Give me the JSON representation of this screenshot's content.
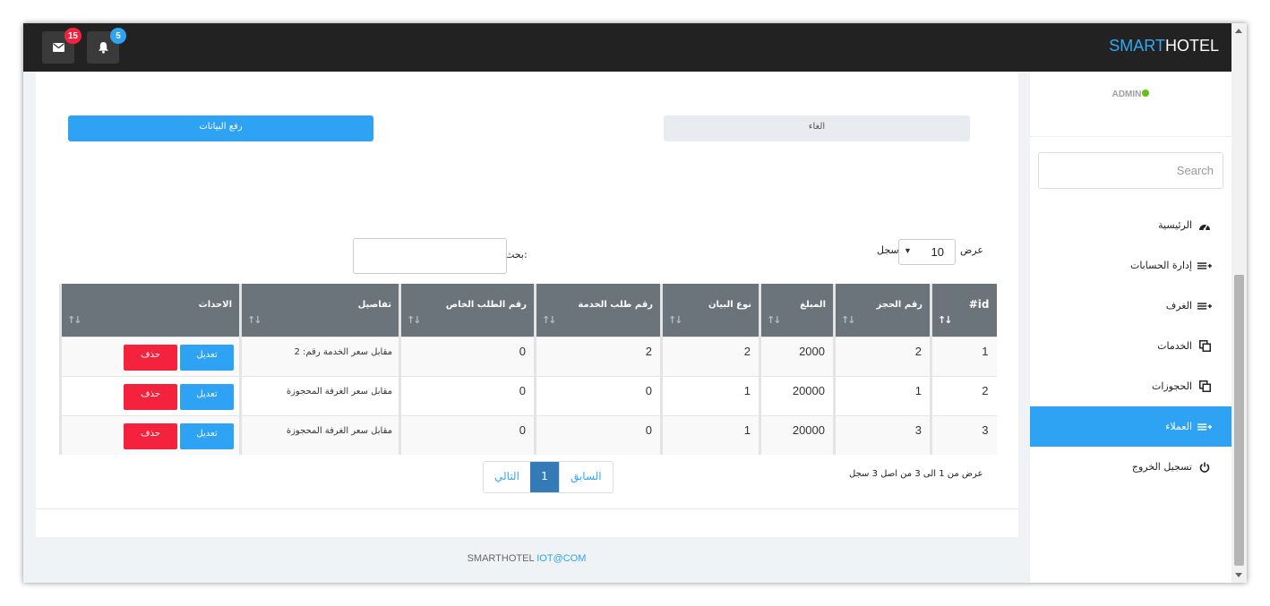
{
  "topbar": {
    "brand_smart": "SMART",
    "brand_hotel": "HOTEL",
    "messages_count": "15",
    "notifications_count": "5",
    "colors": {
      "bar": "#222222",
      "messages_badge": "#f5223e",
      "notifications_badge": "#2fa3f3"
    }
  },
  "sidebar": {
    "user": "ADMIN",
    "search_placeholder": "Search",
    "items": [
      {
        "label": "الرئيسية",
        "icon": "dashboard-icon"
      },
      {
        "label": "إدارة الحسابات",
        "icon": "list-add-icon"
      },
      {
        "label": "الغرف",
        "icon": "list-add-icon"
      },
      {
        "label": "الخدمات",
        "icon": "copy-icon"
      },
      {
        "label": "الحجوزات",
        "icon": "copy-icon"
      },
      {
        "label": "العملاء",
        "icon": "list-add-icon",
        "active": true
      },
      {
        "label": "تسجيل الخروج",
        "icon": "power-icon"
      }
    ],
    "active_color": "#2fa3f3"
  },
  "form": {
    "upload_label": "رفع البيانات",
    "cancel_label": "الغاء"
  },
  "table_controls": {
    "length_prefix": "عرض",
    "length_value": "10",
    "length_suffix": "سجل",
    "search_label": "بحث:"
  },
  "table": {
    "headers": [
      "#id",
      "رقم الحجز",
      "المبلغ",
      "نوع البيان",
      "رقم طلب الخدمة",
      "رقم الطلب الخاص",
      "تفاصيل",
      "الاحداث"
    ],
    "rows": [
      {
        "id": "1",
        "booking": "2",
        "amount": "2000",
        "type": "2",
        "service_req": "2",
        "special_req": "0",
        "details": "2 :مقابل سعر الخدمة رقم"
      },
      {
        "id": "2",
        "booking": "1",
        "amount": "20000",
        "type": "1",
        "service_req": "0",
        "special_req": "0",
        "details": "مقابل سعر الغرفة المحجوزة"
      },
      {
        "id": "3",
        "booking": "3",
        "amount": "20000",
        "type": "1",
        "service_req": "0",
        "special_req": "0",
        "details": "مقابل سعر الغرفة المحجوزة"
      }
    ],
    "edit_label": "تعديل",
    "delete_label": "حذف"
  },
  "pagination": {
    "info": "عرض من 1 الى 3 من اصل 3 سجل",
    "prev_label": "السابق",
    "current_page": "1",
    "next_label": "التالي"
  },
  "footer": {
    "brand": "SMARTHOTEL",
    "link": "IOT@COM"
  }
}
